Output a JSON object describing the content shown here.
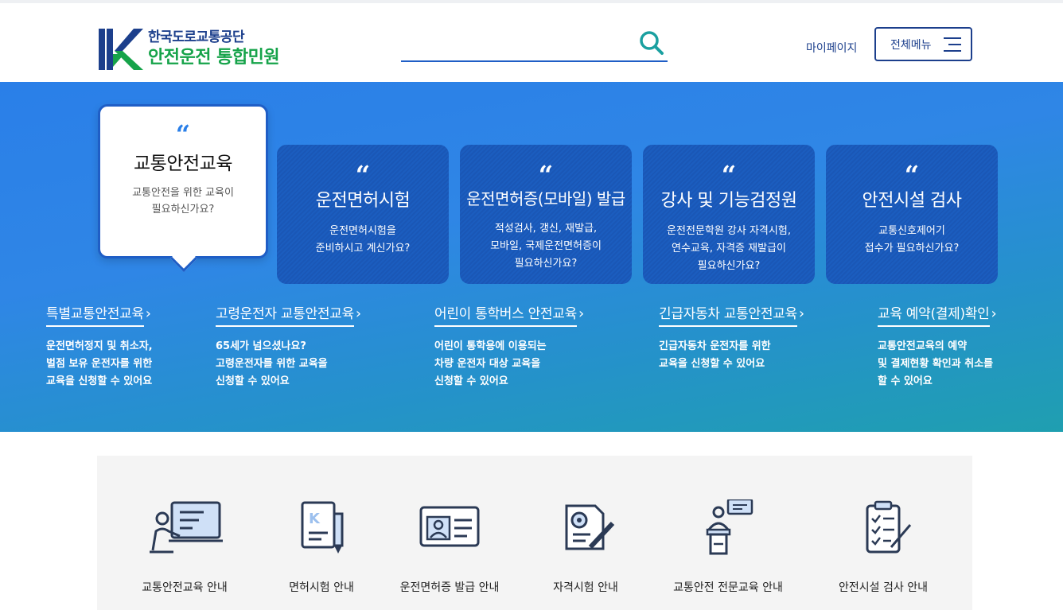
{
  "header": {
    "org_name": "한국도로교통공단",
    "service_name": "안전운전 통합민원",
    "search_placeholder": "",
    "mypage_label": "마이페이지",
    "allmenu_label": "전체메뉴"
  },
  "hero": {
    "main_card": {
      "title": "교통안전교육",
      "desc1": "교통안전을 위한 교육이",
      "desc2": "필요하신가요?"
    },
    "cards": [
      {
        "title": "운전면허시험",
        "desc1": "운전면허시험을",
        "desc2": "준비하시고 계신가요?",
        "desc3": ""
      },
      {
        "title": "운전면허증(모바일) 발급",
        "desc1": "적성검사, 갱신, 재발급,",
        "desc2": "모바일, 국제운전면허증이",
        "desc3": "필요하신가요?"
      },
      {
        "title": "강사 및 기능검정원",
        "desc1": "운전전문학원 강사 자격시험,",
        "desc2": "연수교육, 자격증 재발급이",
        "desc3": "필요하신가요?"
      },
      {
        "title": "안전시설 검사",
        "desc1": "교통신호제어기",
        "desc2": "접수가 필요하신가요?",
        "desc3": ""
      }
    ],
    "links": [
      {
        "title": "특별교통안전교육",
        "d1": "운전면허정지 및 취소자,",
        "d2": "벌점 보유 운전자를 위한",
        "d3": "교육을 신청할 수 있어요"
      },
      {
        "title": "고령운전자 교통안전교육",
        "d1": "65세가 넘으셨나요?",
        "d2": "고령운전자를 위한 교육을",
        "d3": "신청할 수 있어요"
      },
      {
        "title": "어린이 통학버스 안전교육",
        "d1": "어린이 통학용에 이용되는",
        "d2": "차량 운전자 대상 교육을",
        "d3": "신청할 수 있어요"
      },
      {
        "title": "긴급자동차 교통안전교육",
        "d1": "긴급자동차 운전자를 위한",
        "d2": "교육을 신청할 수 있어요",
        "d3": ""
      },
      {
        "title": "교육 예약(결제)확인",
        "d1": "교통안전교육의 예약",
        "d2": "및 결제현황 확인과 취소를",
        "d3": "할 수 있어요"
      }
    ],
    "chevron": "›"
  },
  "guide": {
    "items": [
      {
        "label": "교통안전교육 안내",
        "icon": "presentation-icon"
      },
      {
        "label": "면허시험 안내",
        "icon": "document-pen-icon"
      },
      {
        "label": "운전면허증 발급 안내",
        "icon": "id-card-icon"
      },
      {
        "label": "자격시험 안내",
        "icon": "certificate-pen-icon"
      },
      {
        "label": "교통안전 전문교육 안내",
        "icon": "lecturer-podium-icon"
      },
      {
        "label": "안전시설 검사 안내",
        "icon": "checklist-clipboard-icon"
      }
    ]
  },
  "colors": {
    "brand_blue": "#1c3f8c",
    "brand_green": "#16a34a",
    "hero_blue": "#2a7fe8",
    "card_blue": "#1b5dbf"
  }
}
